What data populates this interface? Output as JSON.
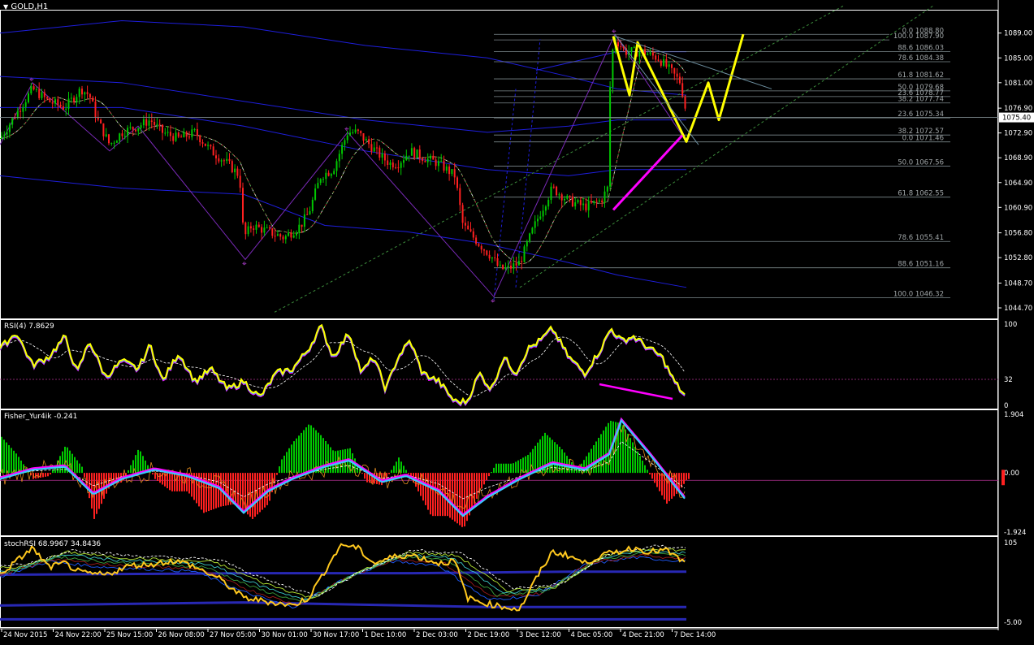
{
  "window": {
    "title": "GOLD,H1",
    "menu_arrow": "triangle-down-icon"
  },
  "colors": {
    "bg": "#000000",
    "grid": "#FFFFFF",
    "bull": "#00C800",
    "bear": "#FF2020",
    "blue": "#1E1EDC",
    "yellow": "#FFFF00",
    "magenta": "#FF00FF",
    "cyan": "#3CC8FF",
    "fib": "#7E8A8E",
    "channel": "#3C8C3C"
  },
  "price_panel": {
    "current_price_label": "1075.40",
    "fib_upper": [
      {
        "ratio": "0.0",
        "price": "1088.80"
      },
      {
        "ratio": "100.0",
        "price": "1087.90"
      },
      {
        "ratio": "88.6",
        "price": "1086.03"
      },
      {
        "ratio": "78.6",
        "price": "1084.38"
      },
      {
        "ratio": "61.8",
        "price": "1081.62"
      },
      {
        "ratio": "50.0",
        "price": "1079.68"
      },
      {
        "ratio": "23.6",
        "price": "1078.77"
      },
      {
        "ratio": "38.2",
        "price": "1077.74"
      },
      {
        "ratio": "23.6",
        "price": "1075.34"
      }
    ],
    "fib_lower": [
      {
        "ratio": "38.2",
        "price": "1072.57"
      },
      {
        "ratio": "0.0",
        "price": "1071.46"
      },
      {
        "ratio": "50.0",
        "price": "1067.56"
      },
      {
        "ratio": "61.8",
        "price": "1062.55"
      },
      {
        "ratio": "78.6",
        "price": "1055.41"
      },
      {
        "ratio": "88.6",
        "price": "1051.16"
      },
      {
        "ratio": "100.0",
        "price": "1046.32"
      }
    ]
  },
  "rsi_panel": {
    "label": "RSI(4) 7.8629",
    "levels": [
      "100",
      "32",
      "0"
    ]
  },
  "fisher_panel": {
    "label": "Fisher_Yur4ik -0.241",
    "levels": [
      "1.904",
      "0.00",
      "-1.924"
    ]
  },
  "stochrsi_panel": {
    "label": "stochRSI 68.9967 34.8436",
    "levels": [
      "105",
      "-5.00"
    ]
  },
  "chart_data": [
    {
      "type": "candlestick",
      "title": "GOLD,H1",
      "ylim": [
        1043.0,
        1092.5
      ],
      "y_ticks": [
        "1089.00",
        "1085.00",
        "1081.00",
        "1076.90",
        "1072.90",
        "1068.90",
        "1064.90",
        "1060.90",
        "1056.80",
        "1052.80",
        "1048.70",
        "1044.70"
      ],
      "x_labels": [
        "24 Nov 2015",
        "24 Nov 22:00",
        "25 Nov 15:00",
        "26 Nov 08:00",
        "27 Nov 05:00",
        "30 Nov 01:00",
        "30 Nov 17:00",
        "1 Dec 10:00",
        "2 Dec 03:00",
        "2 Dec 19:00",
        "3 Dec 12:00",
        "4 Dec 05:00",
        "4 Dec 21:00",
        "7 Dec 14:00"
      ],
      "close_path": [
        [
          0,
          1072
        ],
        [
          20,
          1076
        ],
        [
          40,
          1080
        ],
        [
          60,
          1078
        ],
        [
          80,
          1077
        ],
        [
          100,
          1080
        ],
        [
          110,
          1079
        ],
        [
          120,
          1075
        ],
        [
          135,
          1071
        ],
        [
          150,
          1073
        ],
        [
          170,
          1074
        ],
        [
          185,
          1075
        ],
        [
          200,
          1073
        ],
        [
          220,
          1072
        ],
        [
          240,
          1073
        ],
        [
          260,
          1070
        ],
        [
          280,
          1068
        ],
        [
          295,
          1066
        ],
        [
          300,
          1056
        ],
        [
          310,
          1058
        ],
        [
          330,
          1057
        ],
        [
          350,
          1056
        ],
        [
          370,
          1058
        ],
        [
          380,
          1060
        ],
        [
          395,
          1066
        ],
        [
          410,
          1067
        ],
        [
          428,
          1073
        ],
        [
          440,
          1073
        ],
        [
          455,
          1071
        ],
        [
          470,
          1069
        ],
        [
          480,
          1068
        ],
        [
          490,
          1068
        ],
        [
          505,
          1070
        ],
        [
          520,
          1069
        ],
        [
          540,
          1068
        ],
        [
          560,
          1066
        ],
        [
          570,
          1058
        ],
        [
          590,
          1055
        ],
        [
          605,
          1053
        ],
        [
          615,
          1051
        ],
        [
          625,
          1051
        ],
        [
          640,
          1052
        ],
        [
          655,
          1057
        ],
        [
          665,
          1060
        ],
        [
          680,
          1064
        ],
        [
          700,
          1062
        ],
        [
          720,
          1061
        ],
        [
          740,
          1062
        ],
        [
          748,
          1064
        ],
        [
          752,
          1085
        ],
        [
          758,
          1088
        ],
        [
          770,
          1086
        ],
        [
          790,
          1086
        ],
        [
          810,
          1085
        ],
        [
          825,
          1083
        ],
        [
          838,
          1081
        ],
        [
          845,
          1076
        ]
      ],
      "fib_prices": [
        1088.8,
        1087.9,
        1086.03,
        1084.38,
        1081.62,
        1079.68,
        1078.77,
        1077.74,
        1075.34,
        1072.57,
        1071.46,
        1067.56,
        1062.55,
        1055.41,
        1051.16,
        1046.32
      ],
      "projection_path": [
        [
          755,
          1088.5
        ],
        [
          775,
          1079
        ],
        [
          785,
          1087.5
        ],
        [
          845,
          1071.5
        ],
        [
          872,
          1081
        ],
        [
          885,
          1075
        ],
        [
          915,
          1088.8
        ]
      ],
      "projection_color": "yellow",
      "support_arrow": [
        [
          755,
          1060.5
        ],
        [
          840,
          1072.5
        ]
      ],
      "current_price": 1075.4
    },
    {
      "type": "line",
      "title": "RSI(4) 7.8629",
      "ylim": [
        0,
        100
      ],
      "levels": [
        32
      ],
      "series": [
        {
          "name": "RSI(4)",
          "values": [
            [
              0,
              70
            ],
            [
              20,
              90
            ],
            [
              40,
              50
            ],
            [
              60,
              60
            ],
            [
              80,
              85
            ],
            [
              95,
              40
            ],
            [
              110,
              80
            ],
            [
              130,
              35
            ],
            [
              150,
              55
            ],
            [
              170,
              45
            ],
            [
              185,
              75
            ],
            [
              200,
              30
            ],
            [
              220,
              65
            ],
            [
              240,
              30
            ],
            [
              260,
              45
            ],
            [
              280,
              20
            ],
            [
              300,
              30
            ],
            [
              320,
              10
            ],
            [
              340,
              40
            ],
            [
              360,
              45
            ],
            [
              380,
              70
            ],
            [
              395,
              98
            ],
            [
              410,
              60
            ],
            [
              430,
              90
            ],
            [
              445,
              40
            ],
            [
              460,
              60
            ],
            [
              475,
              20
            ],
            [
              490,
              60
            ],
            [
              505,
              80
            ],
            [
              520,
              40
            ],
            [
              540,
              30
            ],
            [
              560,
              5
            ],
            [
              575,
              5
            ],
            [
              590,
              40
            ],
            [
              605,
              20
            ],
            [
              620,
              60
            ],
            [
              635,
              40
            ],
            [
              650,
              70
            ],
            [
              665,
              80
            ],
            [
              680,
              95
            ],
            [
              700,
              60
            ],
            [
              720,
              40
            ],
            [
              740,
              70
            ],
            [
              752,
              95
            ],
            [
              765,
              80
            ],
            [
              780,
              85
            ],
            [
              800,
              70
            ],
            [
              815,
              60
            ],
            [
              830,
              30
            ],
            [
              845,
              10
            ]
          ]
        }
      ],
      "divergence_line": [
        [
          738,
          32
        ],
        [
          828,
          10
        ]
      ]
    },
    {
      "type": "bar",
      "title": "Fisher_Yur4ik -0.241",
      "ylim": [
        -1.924,
        1.904
      ],
      "histogram": [
        [
          0,
          1.2
        ],
        [
          20,
          0.6
        ],
        [
          40,
          -0.2
        ],
        [
          60,
          -0.1
        ],
        [
          80,
          0.9
        ],
        [
          100,
          0.2
        ],
        [
          115,
          -1.5
        ],
        [
          135,
          -0.4
        ],
        [
          150,
          -0.3
        ],
        [
          170,
          0.8
        ],
        [
          190,
          -0.2
        ],
        [
          210,
          -0.6
        ],
        [
          230,
          -0.6
        ],
        [
          250,
          -1.3
        ],
        [
          270,
          -1.1
        ],
        [
          290,
          -1.0
        ],
        [
          310,
          -1.5
        ],
        [
          330,
          -1.0
        ],
        [
          345,
          0.4
        ],
        [
          360,
          1.0
        ],
        [
          380,
          1.6
        ],
        [
          395,
          1.2
        ],
        [
          410,
          0.7
        ],
        [
          430,
          0.8
        ],
        [
          450,
          -0.3
        ],
        [
          470,
          -0.4
        ],
        [
          490,
          0.5
        ],
        [
          510,
          -0.4
        ],
        [
          530,
          -1.4
        ],
        [
          550,
          -1.4
        ],
        [
          570,
          -1.8
        ],
        [
          590,
          -0.6
        ],
        [
          610,
          0.3
        ],
        [
          630,
          0.3
        ],
        [
          650,
          0.6
        ],
        [
          670,
          1.3
        ],
        [
          690,
          0.8
        ],
        [
          710,
          0.1
        ],
        [
          730,
          0.9
        ],
        [
          750,
          1.7
        ],
        [
          765,
          1.6
        ],
        [
          780,
          0.9
        ],
        [
          800,
          -0.1
        ],
        [
          820,
          -1.0
        ],
        [
          835,
          -0.6
        ],
        [
          845,
          -0.2
        ]
      ],
      "signal_line": [
        [
          0,
          -0.2
        ],
        [
          40,
          0.1
        ],
        [
          80,
          0.2
        ],
        [
          115,
          -0.7
        ],
        [
          150,
          -0.2
        ],
        [
          190,
          0.1
        ],
        [
          230,
          -0.1
        ],
        [
          270,
          -0.5
        ],
        [
          300,
          -1.3
        ],
        [
          330,
          -0.6
        ],
        [
          360,
          -0.2
        ],
        [
          400,
          0.2
        ],
        [
          430,
          0.4
        ],
        [
          470,
          -0.3
        ],
        [
          500,
          -0.1
        ],
        [
          540,
          -0.6
        ],
        [
          570,
          -1.4
        ],
        [
          600,
          -0.8
        ],
        [
          640,
          -0.2
        ],
        [
          680,
          0.3
        ],
        [
          720,
          0.1
        ],
        [
          750,
          0.6
        ],
        [
          765,
          1.7
        ],
        [
          800,
          0.6
        ],
        [
          830,
          -0.4
        ],
        [
          845,
          -0.9
        ]
      ]
    },
    {
      "type": "line",
      "title": "stochRSI 68.9967 34.8436",
      "ylim": [
        -5,
        105
      ],
      "series": [
        {
          "name": "stochRSI",
          "values": [
            [
              0,
              60
            ],
            [
              40,
              95
            ],
            [
              60,
              70
            ],
            [
              80,
              75
            ],
            [
              100,
              62
            ],
            [
              130,
              60
            ],
            [
              160,
              72
            ],
            [
              190,
              74
            ],
            [
              210,
              78
            ],
            [
              230,
              75
            ],
            [
              250,
              65
            ],
            [
              270,
              55
            ],
            [
              300,
              30
            ],
            [
              330,
              25
            ],
            [
              360,
              20
            ],
            [
              380,
              30
            ],
            [
              400,
              65
            ],
            [
              420,
              100
            ],
            [
              440,
              95
            ],
            [
              460,
              75
            ],
            [
              490,
              85
            ],
            [
              510,
              85
            ],
            [
              540,
              75
            ],
            [
              560,
              78
            ],
            [
              575,
              30
            ],
            [
              590,
              25
            ],
            [
              610,
              20
            ],
            [
              640,
              15
            ],
            [
              660,
              55
            ],
            [
              680,
              90
            ],
            [
              700,
              85
            ],
            [
              720,
              75
            ],
            [
              740,
              85
            ],
            [
              760,
              90
            ],
            [
              780,
              95
            ],
            [
              800,
              90
            ],
            [
              820,
              92
            ],
            [
              845,
              74
            ]
          ]
        },
        {
          "name": "signal",
          "values": [
            [
              0,
              65
            ],
            [
              60,
              85
            ],
            [
              120,
              78
            ],
            [
              180,
              75
            ],
            [
              240,
              72
            ],
            [
              300,
              45
            ],
            [
              360,
              25
            ],
            [
              420,
              60
            ],
            [
              480,
              85
            ],
            [
              540,
              80
            ],
            [
              600,
              35
            ],
            [
              660,
              40
            ],
            [
              720,
              80
            ],
            [
              780,
              90
            ],
            [
              845,
              85
            ]
          ]
        }
      ]
    }
  ]
}
